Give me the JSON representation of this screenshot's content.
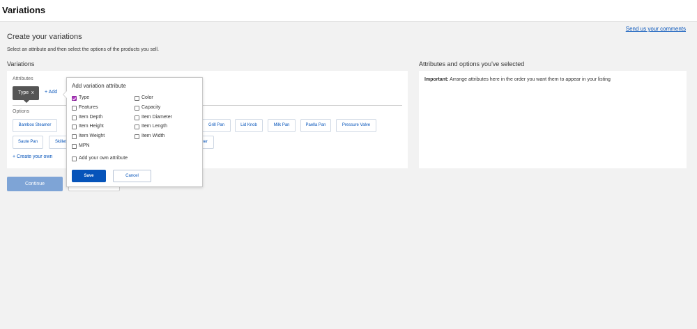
{
  "header": {
    "title": "Variations"
  },
  "feedback_link": "Send us your comments",
  "create": {
    "heading": "Create your variations",
    "subtext": "Select an attribute and then select the options of the products you sell."
  },
  "variations": {
    "heading": "Variations",
    "attributes_label": "Attributes",
    "selected_attribute": {
      "label": "Type",
      "remove": "x"
    },
    "add_link": "+ Add",
    "options_label": "Options",
    "options": [
      "Bamboo Steamer",
      "Grill Pan",
      "Lid Knob",
      "Milk Pan",
      "Paella Pan",
      "Pressure Valve",
      "Saute Pan",
      "Skillet",
      "ner"
    ],
    "create_own": "+ Create your own"
  },
  "selected_panel": {
    "heading": "Attributes and options you've selected",
    "important_label": "Important:",
    "important_text": "Arrange attributes here in the order you want them to appear in your listing"
  },
  "buttons": {
    "continue": "Continue"
  },
  "popup": {
    "title": "Add variation attribute",
    "left_column": [
      {
        "label": "Type",
        "checked": true
      },
      {
        "label": "Features",
        "checked": false
      },
      {
        "label": "Item Depth",
        "checked": false
      },
      {
        "label": "Item Height",
        "checked": false
      },
      {
        "label": "Item Weight",
        "checked": false
      },
      {
        "label": "MPN",
        "checked": false
      }
    ],
    "right_column": [
      {
        "label": "Color",
        "checked": false
      },
      {
        "label": "Capacity",
        "checked": false
      },
      {
        "label": "Item Diameter",
        "checked": false
      },
      {
        "label": "Item Length",
        "checked": false
      },
      {
        "label": "Item Width",
        "checked": false
      }
    ],
    "own_attribute": {
      "label": "Add your own attribute",
      "checked": false
    },
    "save": "Save",
    "cancel": "Cancel"
  },
  "colors": {
    "link": "#0654ba",
    "primary_button": "#0654ba",
    "disabled_button": "#7ea4d6",
    "chip": "#555555",
    "checkbox_checked": "#b03bc2"
  }
}
